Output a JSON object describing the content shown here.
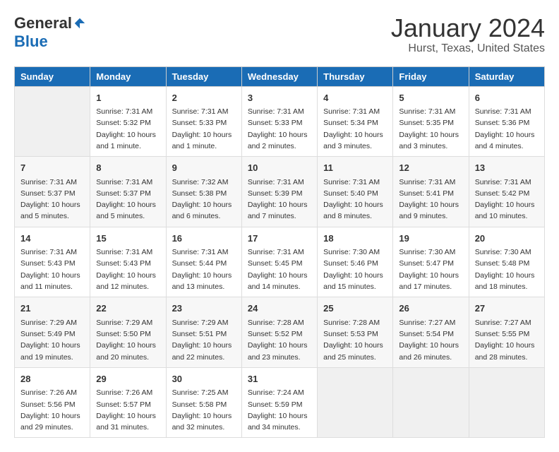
{
  "logo": {
    "general": "General",
    "blue": "Blue"
  },
  "title": "January 2024",
  "subtitle": "Hurst, Texas, United States",
  "days_of_week": [
    "Sunday",
    "Monday",
    "Tuesday",
    "Wednesday",
    "Thursday",
    "Friday",
    "Saturday"
  ],
  "weeks": [
    [
      {
        "day": "",
        "info": ""
      },
      {
        "day": "1",
        "info": "Sunrise: 7:31 AM\nSunset: 5:32 PM\nDaylight: 10 hours\nand 1 minute."
      },
      {
        "day": "2",
        "info": "Sunrise: 7:31 AM\nSunset: 5:33 PM\nDaylight: 10 hours\nand 1 minute."
      },
      {
        "day": "3",
        "info": "Sunrise: 7:31 AM\nSunset: 5:33 PM\nDaylight: 10 hours\nand 2 minutes."
      },
      {
        "day": "4",
        "info": "Sunrise: 7:31 AM\nSunset: 5:34 PM\nDaylight: 10 hours\nand 3 minutes."
      },
      {
        "day": "5",
        "info": "Sunrise: 7:31 AM\nSunset: 5:35 PM\nDaylight: 10 hours\nand 3 minutes."
      },
      {
        "day": "6",
        "info": "Sunrise: 7:31 AM\nSunset: 5:36 PM\nDaylight: 10 hours\nand 4 minutes."
      }
    ],
    [
      {
        "day": "7",
        "info": "Sunrise: 7:31 AM\nSunset: 5:37 PM\nDaylight: 10 hours\nand 5 minutes."
      },
      {
        "day": "8",
        "info": "Sunrise: 7:31 AM\nSunset: 5:37 PM\nDaylight: 10 hours\nand 5 minutes."
      },
      {
        "day": "9",
        "info": "Sunrise: 7:32 AM\nSunset: 5:38 PM\nDaylight: 10 hours\nand 6 minutes."
      },
      {
        "day": "10",
        "info": "Sunrise: 7:31 AM\nSunset: 5:39 PM\nDaylight: 10 hours\nand 7 minutes."
      },
      {
        "day": "11",
        "info": "Sunrise: 7:31 AM\nSunset: 5:40 PM\nDaylight: 10 hours\nand 8 minutes."
      },
      {
        "day": "12",
        "info": "Sunrise: 7:31 AM\nSunset: 5:41 PM\nDaylight: 10 hours\nand 9 minutes."
      },
      {
        "day": "13",
        "info": "Sunrise: 7:31 AM\nSunset: 5:42 PM\nDaylight: 10 hours\nand 10 minutes."
      }
    ],
    [
      {
        "day": "14",
        "info": "Sunrise: 7:31 AM\nSunset: 5:43 PM\nDaylight: 10 hours\nand 11 minutes."
      },
      {
        "day": "15",
        "info": "Sunrise: 7:31 AM\nSunset: 5:43 PM\nDaylight: 10 hours\nand 12 minutes."
      },
      {
        "day": "16",
        "info": "Sunrise: 7:31 AM\nSunset: 5:44 PM\nDaylight: 10 hours\nand 13 minutes."
      },
      {
        "day": "17",
        "info": "Sunrise: 7:31 AM\nSunset: 5:45 PM\nDaylight: 10 hours\nand 14 minutes."
      },
      {
        "day": "18",
        "info": "Sunrise: 7:30 AM\nSunset: 5:46 PM\nDaylight: 10 hours\nand 15 minutes."
      },
      {
        "day": "19",
        "info": "Sunrise: 7:30 AM\nSunset: 5:47 PM\nDaylight: 10 hours\nand 17 minutes."
      },
      {
        "day": "20",
        "info": "Sunrise: 7:30 AM\nSunset: 5:48 PM\nDaylight: 10 hours\nand 18 minutes."
      }
    ],
    [
      {
        "day": "21",
        "info": "Sunrise: 7:29 AM\nSunset: 5:49 PM\nDaylight: 10 hours\nand 19 minutes."
      },
      {
        "day": "22",
        "info": "Sunrise: 7:29 AM\nSunset: 5:50 PM\nDaylight: 10 hours\nand 20 minutes."
      },
      {
        "day": "23",
        "info": "Sunrise: 7:29 AM\nSunset: 5:51 PM\nDaylight: 10 hours\nand 22 minutes."
      },
      {
        "day": "24",
        "info": "Sunrise: 7:28 AM\nSunset: 5:52 PM\nDaylight: 10 hours\nand 23 minutes."
      },
      {
        "day": "25",
        "info": "Sunrise: 7:28 AM\nSunset: 5:53 PM\nDaylight: 10 hours\nand 25 minutes."
      },
      {
        "day": "26",
        "info": "Sunrise: 7:27 AM\nSunset: 5:54 PM\nDaylight: 10 hours\nand 26 minutes."
      },
      {
        "day": "27",
        "info": "Sunrise: 7:27 AM\nSunset: 5:55 PM\nDaylight: 10 hours\nand 28 minutes."
      }
    ],
    [
      {
        "day": "28",
        "info": "Sunrise: 7:26 AM\nSunset: 5:56 PM\nDaylight: 10 hours\nand 29 minutes."
      },
      {
        "day": "29",
        "info": "Sunrise: 7:26 AM\nSunset: 5:57 PM\nDaylight: 10 hours\nand 31 minutes."
      },
      {
        "day": "30",
        "info": "Sunrise: 7:25 AM\nSunset: 5:58 PM\nDaylight: 10 hours\nand 32 minutes."
      },
      {
        "day": "31",
        "info": "Sunrise: 7:24 AM\nSunset: 5:59 PM\nDaylight: 10 hours\nand 34 minutes."
      },
      {
        "day": "",
        "info": ""
      },
      {
        "day": "",
        "info": ""
      },
      {
        "day": "",
        "info": ""
      }
    ]
  ]
}
